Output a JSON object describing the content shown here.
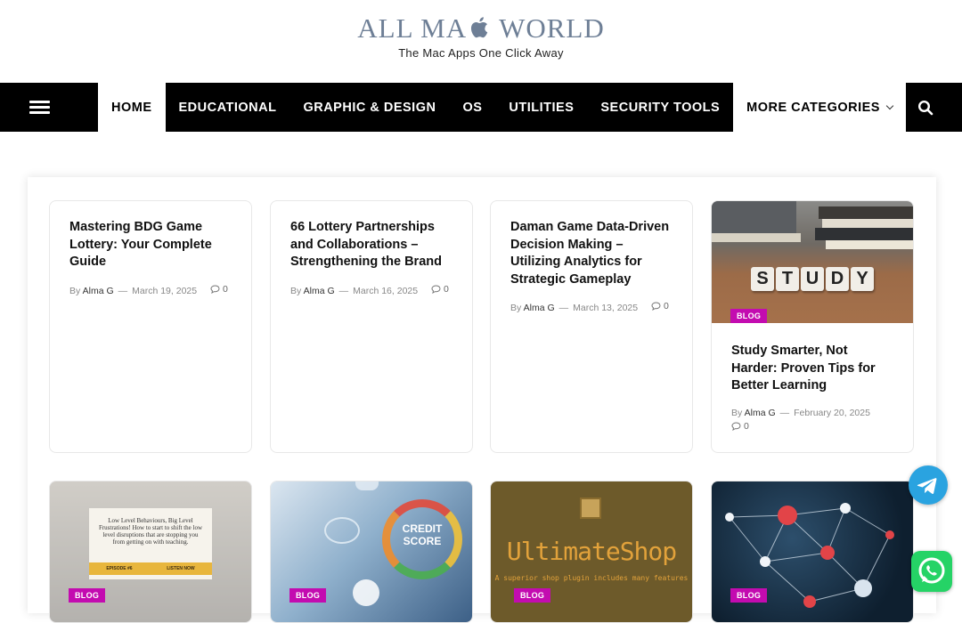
{
  "site": {
    "logo_left": "ALL MA",
    "logo_right": "WORLD",
    "tagline": "The Mac Apps One Click Away"
  },
  "nav": {
    "items": [
      {
        "label": "HOME"
      },
      {
        "label": "EDUCATIONAL"
      },
      {
        "label": "GRAPHIC & DESIGN"
      },
      {
        "label": "OS"
      },
      {
        "label": "UTILITIES"
      },
      {
        "label": "SECURITY TOOLS"
      },
      {
        "label": "MORE CATEGORIES"
      }
    ]
  },
  "posts": [
    {
      "title": "Mastering BDG Game Lottery: Your Complete Guide",
      "by": "By",
      "author": "Alma G",
      "date": "March 19, 2025",
      "comments": "0"
    },
    {
      "title": "66 Lottery Partnerships and Collaborations – Strengthening the Brand",
      "by": "By",
      "author": "Alma G",
      "date": "March 16, 2025",
      "comments": "0"
    },
    {
      "title": "Daman Game Data-Driven Decision Making – Utilizing Analytics for Strategic Gameplay",
      "by": "By",
      "author": "Alma G",
      "date": "March 13, 2025",
      "comments": "0"
    },
    {
      "title": "Study Smarter, Not Harder: Proven Tips for Better Learning",
      "by": "By",
      "author": "Alma G",
      "date": "February 20, 2025",
      "comments": "0",
      "category": "BLOG",
      "image_text": "STUDY"
    }
  ],
  "bottom_row": [
    {
      "category": "BLOG",
      "image_text": "Low Level Behaviours, Big Level Frustrations! How to start to shift the low level disruptions that are stopping you from getting on with teaching.",
      "image_sub1": "EPISODE #6",
      "image_sub2": "LISTEN NOW"
    },
    {
      "category": "BLOG",
      "image_text": "CREDIT SCORE"
    },
    {
      "category": "BLOG",
      "image_text": "UltimateShop",
      "image_sub1": "A superior shop plugin includes many features"
    },
    {
      "category": "BLOG"
    }
  ],
  "colors": {
    "badge": "#c30bb0",
    "nav_bg": "#000000",
    "telegram": "#2aa3e0",
    "whatsapp": "#25d366"
  }
}
